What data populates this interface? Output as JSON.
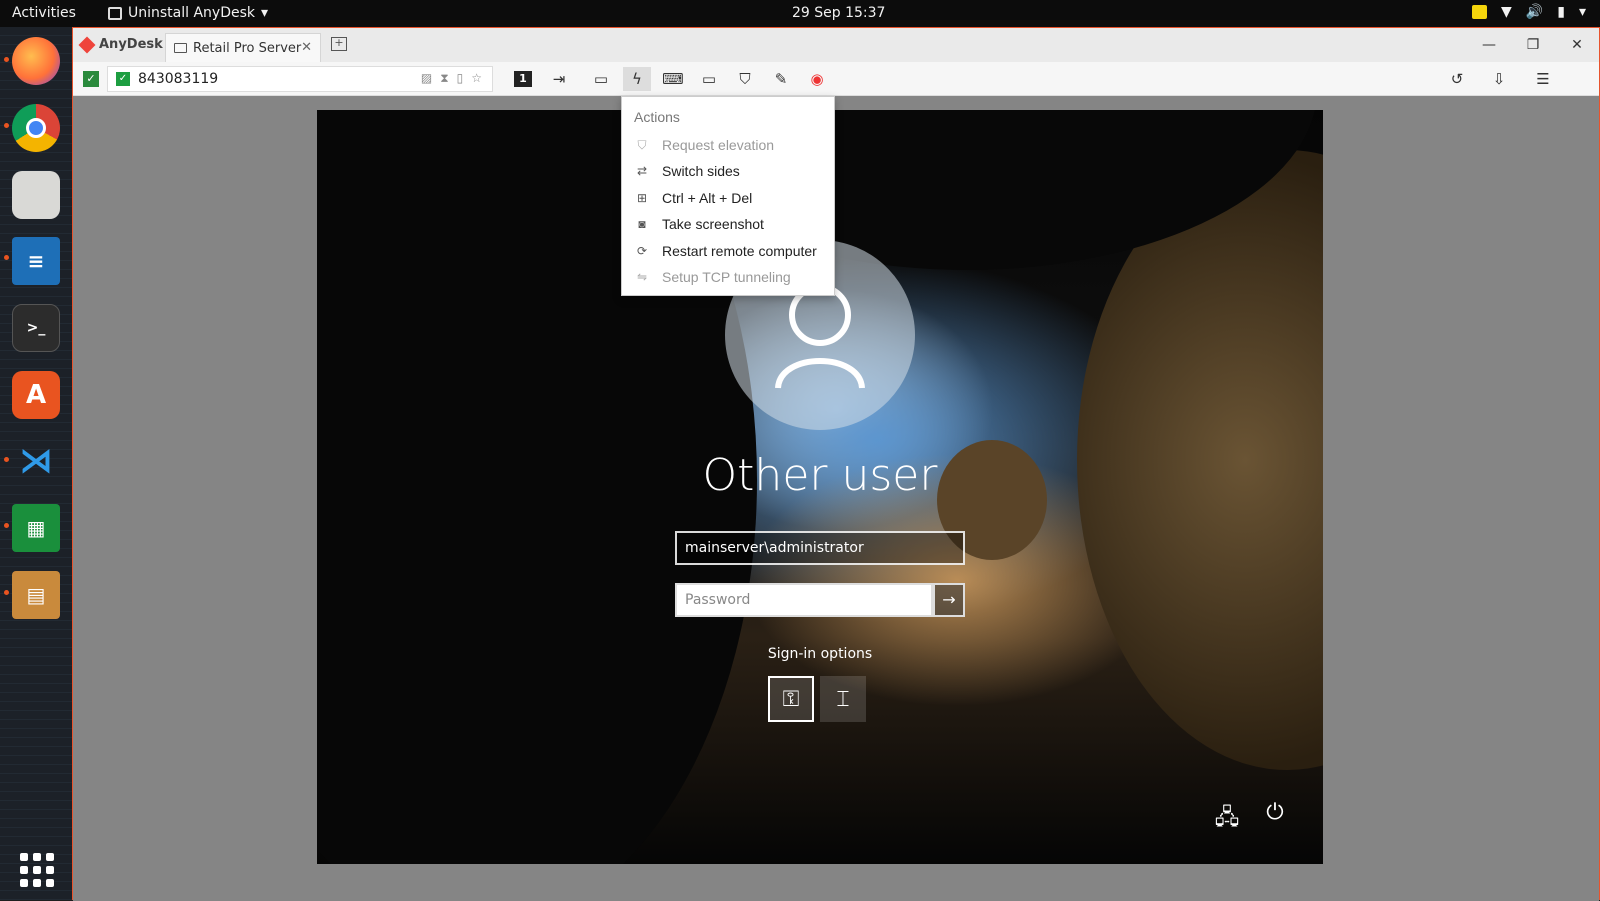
{
  "topbar": {
    "activities": "Activities",
    "app_menu": "Uninstall AnyDesk",
    "clock": "29 Sep  15:37"
  },
  "dock": {
    "apps": [
      "firefox-icon",
      "chrome-icon",
      "files-icon",
      "writer-icon",
      "terminal-icon",
      "app-center-icon",
      "vscode-icon",
      "calc-icon",
      "archive-icon",
      "show-apps-icon"
    ]
  },
  "anydesk": {
    "brand": "AnyDesk",
    "tab_label": "Retail Pro Server",
    "address": "843083119",
    "monitor_number": "1"
  },
  "actions_menu": {
    "header": "Actions",
    "items": [
      {
        "label": "Request elevation",
        "enabled": false
      },
      {
        "label": "Switch sides",
        "enabled": true
      },
      {
        "label": "Ctrl + Alt + Del",
        "enabled": true
      },
      {
        "label": "Take screenshot",
        "enabled": true
      },
      {
        "label": "Restart remote computer",
        "enabled": true
      },
      {
        "label": "Setup TCP tunneling",
        "enabled": false
      }
    ]
  },
  "login": {
    "title": "Other user",
    "username": "mainserver\\administrator",
    "password_placeholder": "Password",
    "signin_options_label": "Sign-in options"
  },
  "colors": {
    "anydesk_red": "#ef443b",
    "ubuntu_orange": "#e95420",
    "topbar_bg": "#0c0c0c"
  }
}
